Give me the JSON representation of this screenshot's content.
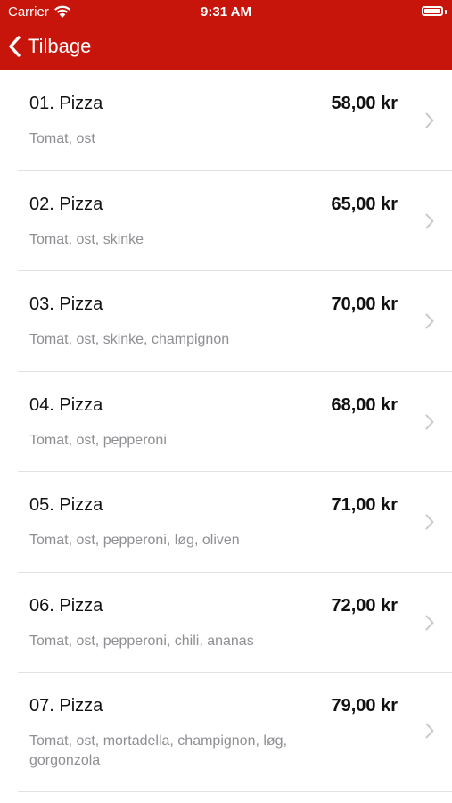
{
  "status": {
    "carrier": "Carrier",
    "time": "9:31 AM"
  },
  "nav": {
    "back_label": "Tilbage"
  },
  "colors": {
    "accent": "#c8150b",
    "separator": "#e2e2e2",
    "secondary_text": "#8e8e93"
  },
  "icons": {
    "back": "chevron-left-icon",
    "row": "chevron-right-icon",
    "wifi": "wifi-icon",
    "battery": "battery-icon"
  },
  "items": [
    {
      "name": "01. Pizza",
      "price": "58,00 kr",
      "description": "Tomat, ost"
    },
    {
      "name": "02. Pizza",
      "price": "65,00 kr",
      "description": "Tomat, ost, skinke"
    },
    {
      "name": "03. Pizza",
      "price": "70,00 kr",
      "description": "Tomat, ost, skinke, champignon"
    },
    {
      "name": "04. Pizza",
      "price": "68,00 kr",
      "description": "Tomat, ost, pepperoni"
    },
    {
      "name": "05. Pizza",
      "price": "71,00 kr",
      "description": "Tomat, ost, pepperoni, løg, oliven"
    },
    {
      "name": "06. Pizza",
      "price": "72,00 kr",
      "description": "Tomat, ost, pepperoni, chili, ananas"
    },
    {
      "name": "07. Pizza",
      "price": "79,00 kr",
      "description": "Tomat, ost, mortadella, champignon, løg, gorgonzola"
    }
  ]
}
